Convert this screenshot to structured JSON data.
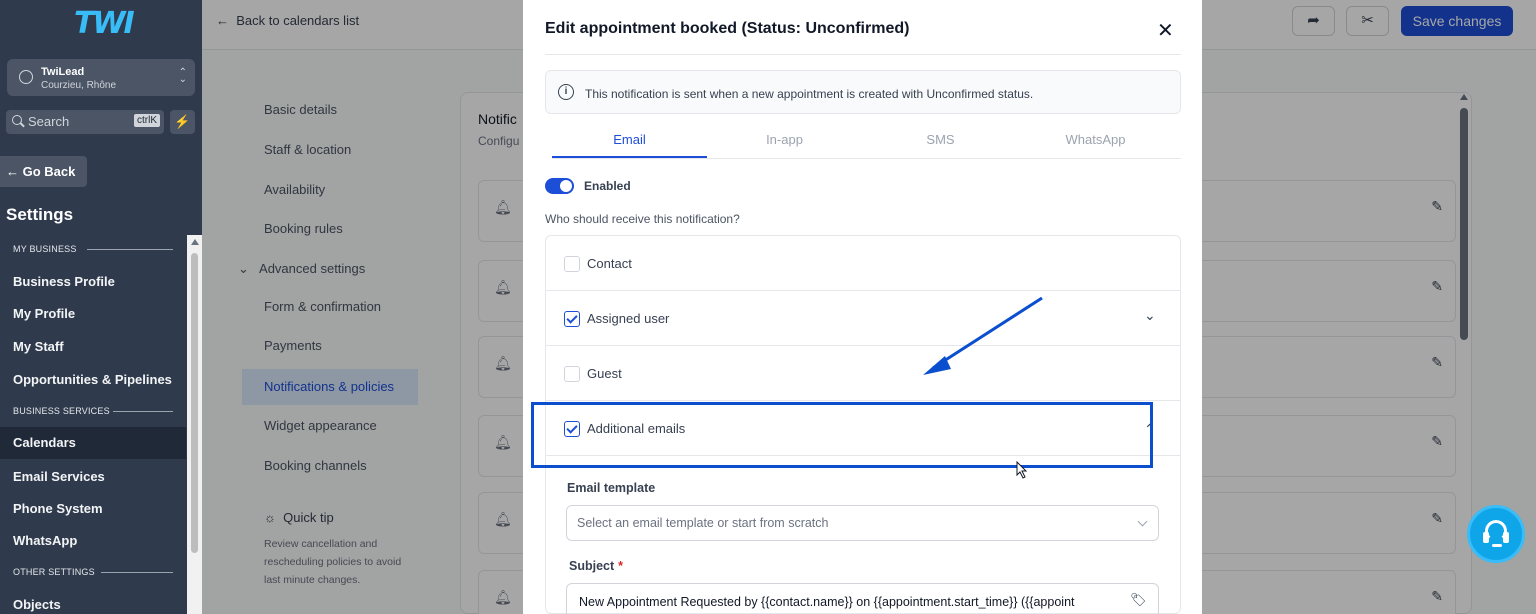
{
  "sidebar": {
    "logo": "TWI",
    "account": {
      "name": "TwiLead",
      "location": "Courzieu, Rhône"
    },
    "search": {
      "placeholder": "Search",
      "shortcut": "ctrlK"
    },
    "go_back": "Go Back",
    "title": "Settings",
    "sections": [
      "MY BUSINESS",
      "BUSINESS SERVICES",
      "OTHER SETTINGS"
    ],
    "items": [
      "Business Profile",
      "My Profile",
      "My Staff",
      "Opportunities & Pipelines",
      "Calendars",
      "Email Services",
      "Phone System",
      "WhatsApp",
      "Objects"
    ],
    "active_item": "Calendars"
  },
  "page": {
    "back_link": "Back to calendars list",
    "save_button": "Save changes",
    "subnav": [
      "Basic details",
      "Staff & location",
      "Availability",
      "Booking rules",
      "Advanced settings",
      "Form & confirmation",
      "Payments",
      "Notifications & policies",
      "Widget appearance",
      "Booking channels"
    ],
    "active_subnav": "Notifications & policies",
    "tip": {
      "title": "Quick tip",
      "lines": [
        "Review cancellation and",
        "rescheduling policies to avoid",
        "last minute changes."
      ]
    },
    "card": {
      "title": "Notific",
      "subtitle": "Configu"
    }
  },
  "modal": {
    "title": "Edit appointment booked (Status: Unconfirmed)",
    "info": "This notification is sent when a new appointment is created with Unconfirmed status.",
    "tabs": [
      "Email",
      "In-app",
      "SMS",
      "WhatsApp"
    ],
    "active_tab": "Email",
    "enabled_label": "Enabled",
    "enabled": true,
    "recipients_question": "Who should receive this notification?",
    "recipients": [
      {
        "label": "Contact",
        "checked": false
      },
      {
        "label": "Assigned user",
        "checked": true
      },
      {
        "label": "Guest",
        "checked": false
      },
      {
        "label": "Additional emails",
        "checked": true
      }
    ],
    "email_template_label": "Email template",
    "email_template_placeholder": "Select an email template or start from scratch",
    "subject_label": "Subject",
    "subject_required": "*",
    "subject_value": "New Appointment Requested by {{contact.name}} on {{appointment.start_time}} ({{appoint"
  },
  "colors": {
    "accent": "#1d4ed8",
    "sidebar": "#2f3b4c",
    "annotation": "#0b4fcf"
  }
}
